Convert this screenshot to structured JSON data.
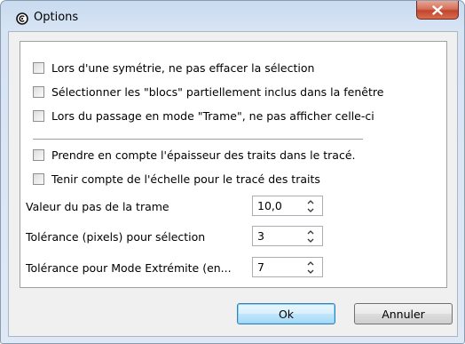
{
  "window": {
    "title": "Options",
    "app_icon": "app-logo-icon",
    "close_icon": "close-icon"
  },
  "checkboxes": [
    {
      "label": "Lors d'une symétrie, ne pas effacer la sélection",
      "checked": false
    },
    {
      "label": "Sélectionner les \"blocs\" partiellement inclus dans la fenêtre",
      "checked": false
    },
    {
      "label": "Lors du passage en mode \"Trame\", ne pas afficher celle-ci",
      "checked": false
    },
    {
      "label": "Prendre en compte l'épaisseur des traits dans le tracé.",
      "checked": false
    },
    {
      "label": "Tenir compte de l'échelle pour le tracé des traits",
      "checked": false
    }
  ],
  "fields": [
    {
      "label": "Valeur du pas de la trame",
      "value": "10,0"
    },
    {
      "label": "Tolérance (pixels) pour sélection",
      "value": "3"
    },
    {
      "label": "Tolérance pour Mode Extrémite (en...",
      "value": "7"
    }
  ],
  "buttons": {
    "ok": "Ok",
    "cancel": "Annuler"
  }
}
